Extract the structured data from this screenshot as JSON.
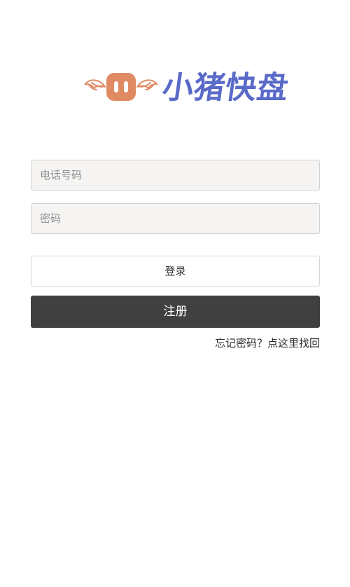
{
  "app": {
    "logo_text": "小猪快盘",
    "brand_color": "#5a6ac8",
    "logo_mark_color": "#e08a64",
    "logo_mark": "pig-snout-with-wings-icon"
  },
  "form": {
    "phone_placeholder": "电话号码",
    "password_placeholder": "密码",
    "login_label": "登录",
    "register_label": "注册",
    "forgot_link": "忘记密码？点这里找回"
  },
  "colors": {
    "register_bg": "#404040",
    "field_bg": "#f5f4f2"
  }
}
